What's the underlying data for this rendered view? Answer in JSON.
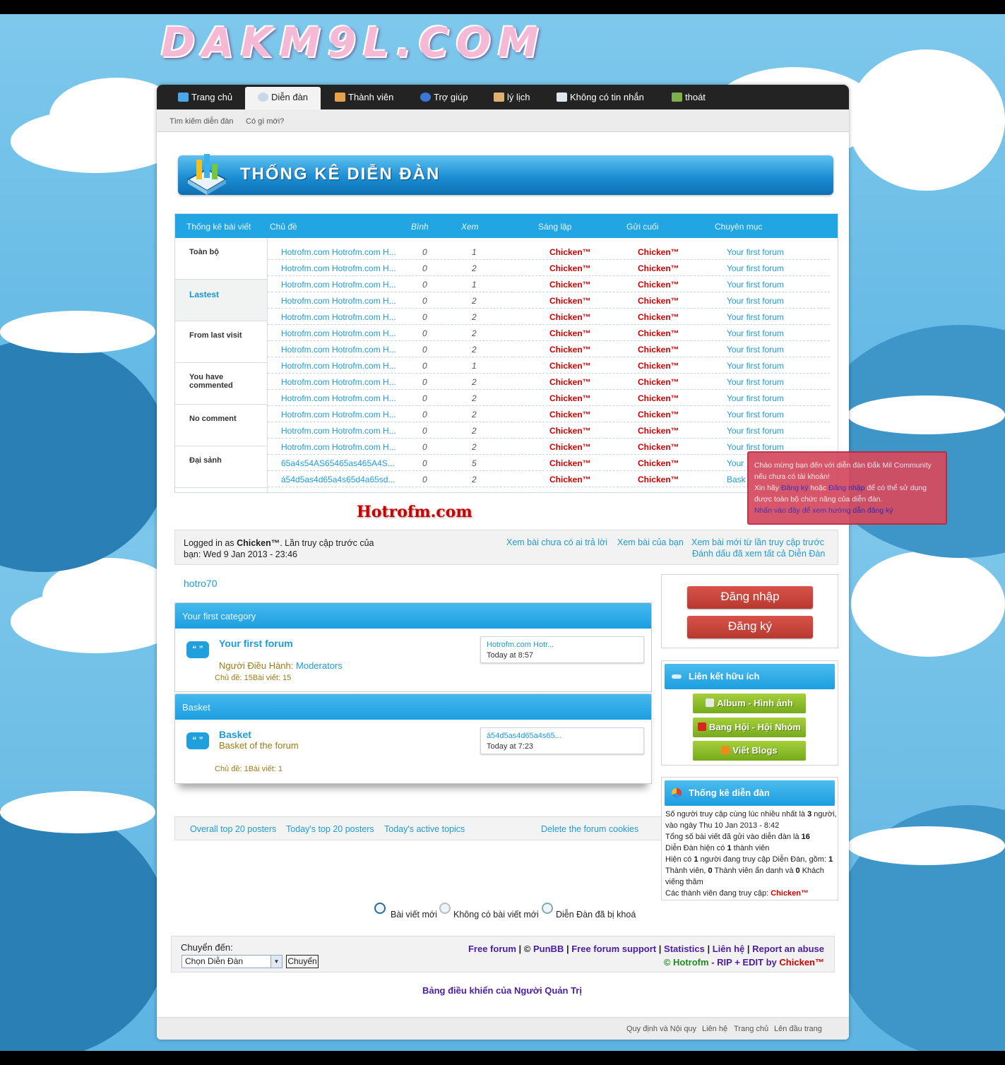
{
  "logo_text": "DAKM9L.COM",
  "nav": {
    "tabs": [
      {
        "label": "Trang chủ",
        "icon": "home-icon"
      },
      {
        "label": "Diễn đàn",
        "icon": "speech-bubble-icon",
        "active": true
      },
      {
        "label": "Thành viên",
        "icon": "members-icon"
      },
      {
        "label": "Trợ giúp",
        "icon": "help-icon"
      },
      {
        "label": "lý lịch",
        "icon": "profile-icon"
      },
      {
        "label": "Không có tin nhắn",
        "icon": "envelope-icon"
      },
      {
        "label": "thoát",
        "icon": "logout-icon"
      }
    ],
    "sub": [
      "Tìm kiếm diễn đàn",
      "Có gì mới?"
    ]
  },
  "banner_title": "THỐNG KÊ DIỄN ĐÀN",
  "stats": {
    "headers": [
      "Thống kê bài viết",
      "Chủ đề",
      "Bình",
      "Xem",
      "Sáng lập",
      "Gửi cuối",
      "Chuyên mục"
    ],
    "tabs": [
      "Toàn bộ",
      "Lastest",
      "From last visit",
      "You have commented",
      "No comment",
      "Đại sảnh"
    ],
    "rows": [
      {
        "title": "Hotrofm.com Hotrofm.com H...",
        "replies": "0",
        "views": "1",
        "author": "Chicken™",
        "last": "Chicken™",
        "forum": "Your first forum"
      },
      {
        "title": "Hotrofm.com Hotrofm.com H...",
        "replies": "0",
        "views": "2",
        "author": "Chicken™",
        "last": "Chicken™",
        "forum": "Your first forum"
      },
      {
        "title": "Hotrofm.com Hotrofm.com H...",
        "replies": "0",
        "views": "1",
        "author": "Chicken™",
        "last": "Chicken™",
        "forum": "Your first forum"
      },
      {
        "title": "Hotrofm.com Hotrofm.com H...",
        "replies": "0",
        "views": "2",
        "author": "Chicken™",
        "last": "Chicken™",
        "forum": "Your first forum"
      },
      {
        "title": "Hotrofm.com Hotrofm.com H...",
        "replies": "0",
        "views": "2",
        "author": "Chicken™",
        "last": "Chicken™",
        "forum": "Your first forum"
      },
      {
        "title": "Hotrofm.com Hotrofm.com H...",
        "replies": "0",
        "views": "2",
        "author": "Chicken™",
        "last": "Chicken™",
        "forum": "Your first forum"
      },
      {
        "title": "Hotrofm.com Hotrofm.com H...",
        "replies": "0",
        "views": "2",
        "author": "Chicken™",
        "last": "Chicken™",
        "forum": "Your first forum"
      },
      {
        "title": "Hotrofm.com Hotrofm.com H...",
        "replies": "0",
        "views": "1",
        "author": "Chicken™",
        "last": "Chicken™",
        "forum": "Your first forum"
      },
      {
        "title": "Hotrofm.com Hotrofm.com H...",
        "replies": "0",
        "views": "2",
        "author": "Chicken™",
        "last": "Chicken™",
        "forum": "Your first forum"
      },
      {
        "title": "Hotrofm.com Hotrofm.com H...",
        "replies": "0",
        "views": "2",
        "author": "Chicken™",
        "last": "Chicken™",
        "forum": "Your first forum"
      },
      {
        "title": "Hotrofm.com Hotrofm.com H...",
        "replies": "0",
        "views": "2",
        "author": "Chicken™",
        "last": "Chicken™",
        "forum": "Your first forum"
      },
      {
        "title": "Hotrofm.com Hotrofm.com H...",
        "replies": "0",
        "views": "2",
        "author": "Chicken™",
        "last": "Chicken™",
        "forum": "Your first forum"
      },
      {
        "title": "Hotrofm.com Hotrofm.com H...",
        "replies": "0",
        "views": "2",
        "author": "Chicken™",
        "last": "Chicken™",
        "forum": "Your first forum"
      },
      {
        "title": "65a4s54AS65465as465A4S...",
        "replies": "0",
        "views": "5",
        "author": "Chicken™",
        "last": "Chicken™",
        "forum": "Your"
      },
      {
        "title": "á54d5as4d65a4s65d4a65sd...",
        "replies": "0",
        "views": "2",
        "author": "Chicken™",
        "last": "Chicken™",
        "forum": "Bask"
      }
    ]
  },
  "watermark": "Hotrofm.com",
  "tooltip": {
    "line1": "Chào mừng bạn đến với diễn đàn Đắk Mil Community",
    "line2": "nếu chưa có tài khoản!",
    "line3_pre": "Xin hãy",
    "register": "Đăng ký",
    "or": "hoặc",
    "login": "Đăng nhập",
    "line3_post": "để có thể sử dụng",
    "line4": "được toàn bộ chức năng của diễn đàn.",
    "guide": "Nhấn vào đây để xem hướng dẫn đăng ký"
  },
  "login_bar": {
    "prefix": "Logged in as",
    "user": "Chicken™",
    "suffix": ". Lần truy cập trước của",
    "line2": "bạn: Wed 9 Jan 2013 - 23:46",
    "links": [
      "Xem bài chưa có ai trả lời",
      "Xem bài của bạn",
      "Xem bài mới từ lần truy cập trước",
      "Đánh dấu đã xem tất cả Diễn Đàn"
    ]
  },
  "hotro70": "hotro70",
  "categories": [
    {
      "name": "Your first category",
      "forum": "Your first forum",
      "mod_label": "Người Điều Hành:",
      "mod_value": "Moderators",
      "stats": "Chủ đề: 15Bài viết: 15",
      "last_title": "Hotrofm.com Hotr...",
      "last_time": "Today at 8:57"
    },
    {
      "name": "Basket",
      "forum": "Basket",
      "desc": "Basket of the forum",
      "stats": "Chủ đề: 1Bài viết: 1",
      "last_title": "á54d5as4d65a4s65...",
      "last_time": "Today at 7:23"
    }
  ],
  "quick_links": [
    "Overall top 20 posters",
    "Today's top 20 posters",
    "Today's active topics",
    "Delete the forum cookies"
  ],
  "auth": {
    "login": "Đăng nhập",
    "register": "Đăng ký"
  },
  "useful_links": {
    "title": "Liên kết hữu ích",
    "buttons": [
      "Album - Hình ảnh",
      "Bang Hội - Hội Nhóm",
      "Viết Blogs"
    ]
  },
  "forum_stats": {
    "title": "Thống kê diễn đàn",
    "l1a": "Số người truy cập cùng lúc nhiều nhất là",
    "l1b": "3",
    "l1c": "người,",
    "l2": "vào ngày Thu 10 Jan 2013 - 8:42",
    "l3a": "Tổng số bài viết đã gửi vào diễn đàn là",
    "l3b": "16",
    "l4a": "Diễn Đàn hiện có",
    "l4b": "1",
    "l4c": "thành viên",
    "l5a": "Hiện có",
    "l5b": "1",
    "l5c": "người đang truy cập Diễn Đàn, gồm:",
    "l5d": "1",
    "l6a": "Thành viên,",
    "l6b": "0",
    "l6c": "Thành viên ẩn danh và",
    "l6d": "0",
    "l6e": "Khách",
    "l7": "viếng thăm",
    "l8a": "Các thành viên đang truy cập:",
    "l8b": "Chicken™"
  },
  "legend": [
    "Bài viết mới",
    "Không có bài viết mới",
    "Diễn Đàn đã bị khoá"
  ],
  "footer": {
    "jump_label": "Chuyển đến:",
    "jump_select": "Chọn Diễn Đàn",
    "jump_btn": "Chuyển",
    "c1": "Free forum",
    "c2": "©",
    "c3": "PunBB",
    "c4": "Free forum support",
    "c5": "Statistics",
    "c6": "Liên hệ",
    "c7": "Report an abuse",
    "c8": "© Hotrofm",
    "c9": "- RIP + EDIT by",
    "c10": "Chicken™",
    "sep": "|"
  },
  "admin_link": "Bảng điều khiển của Người Quản Trị",
  "bottom_links": [
    "Quy định và Nội quy",
    "Liên hệ",
    "Trang chủ",
    "Lên đầu trang"
  ]
}
